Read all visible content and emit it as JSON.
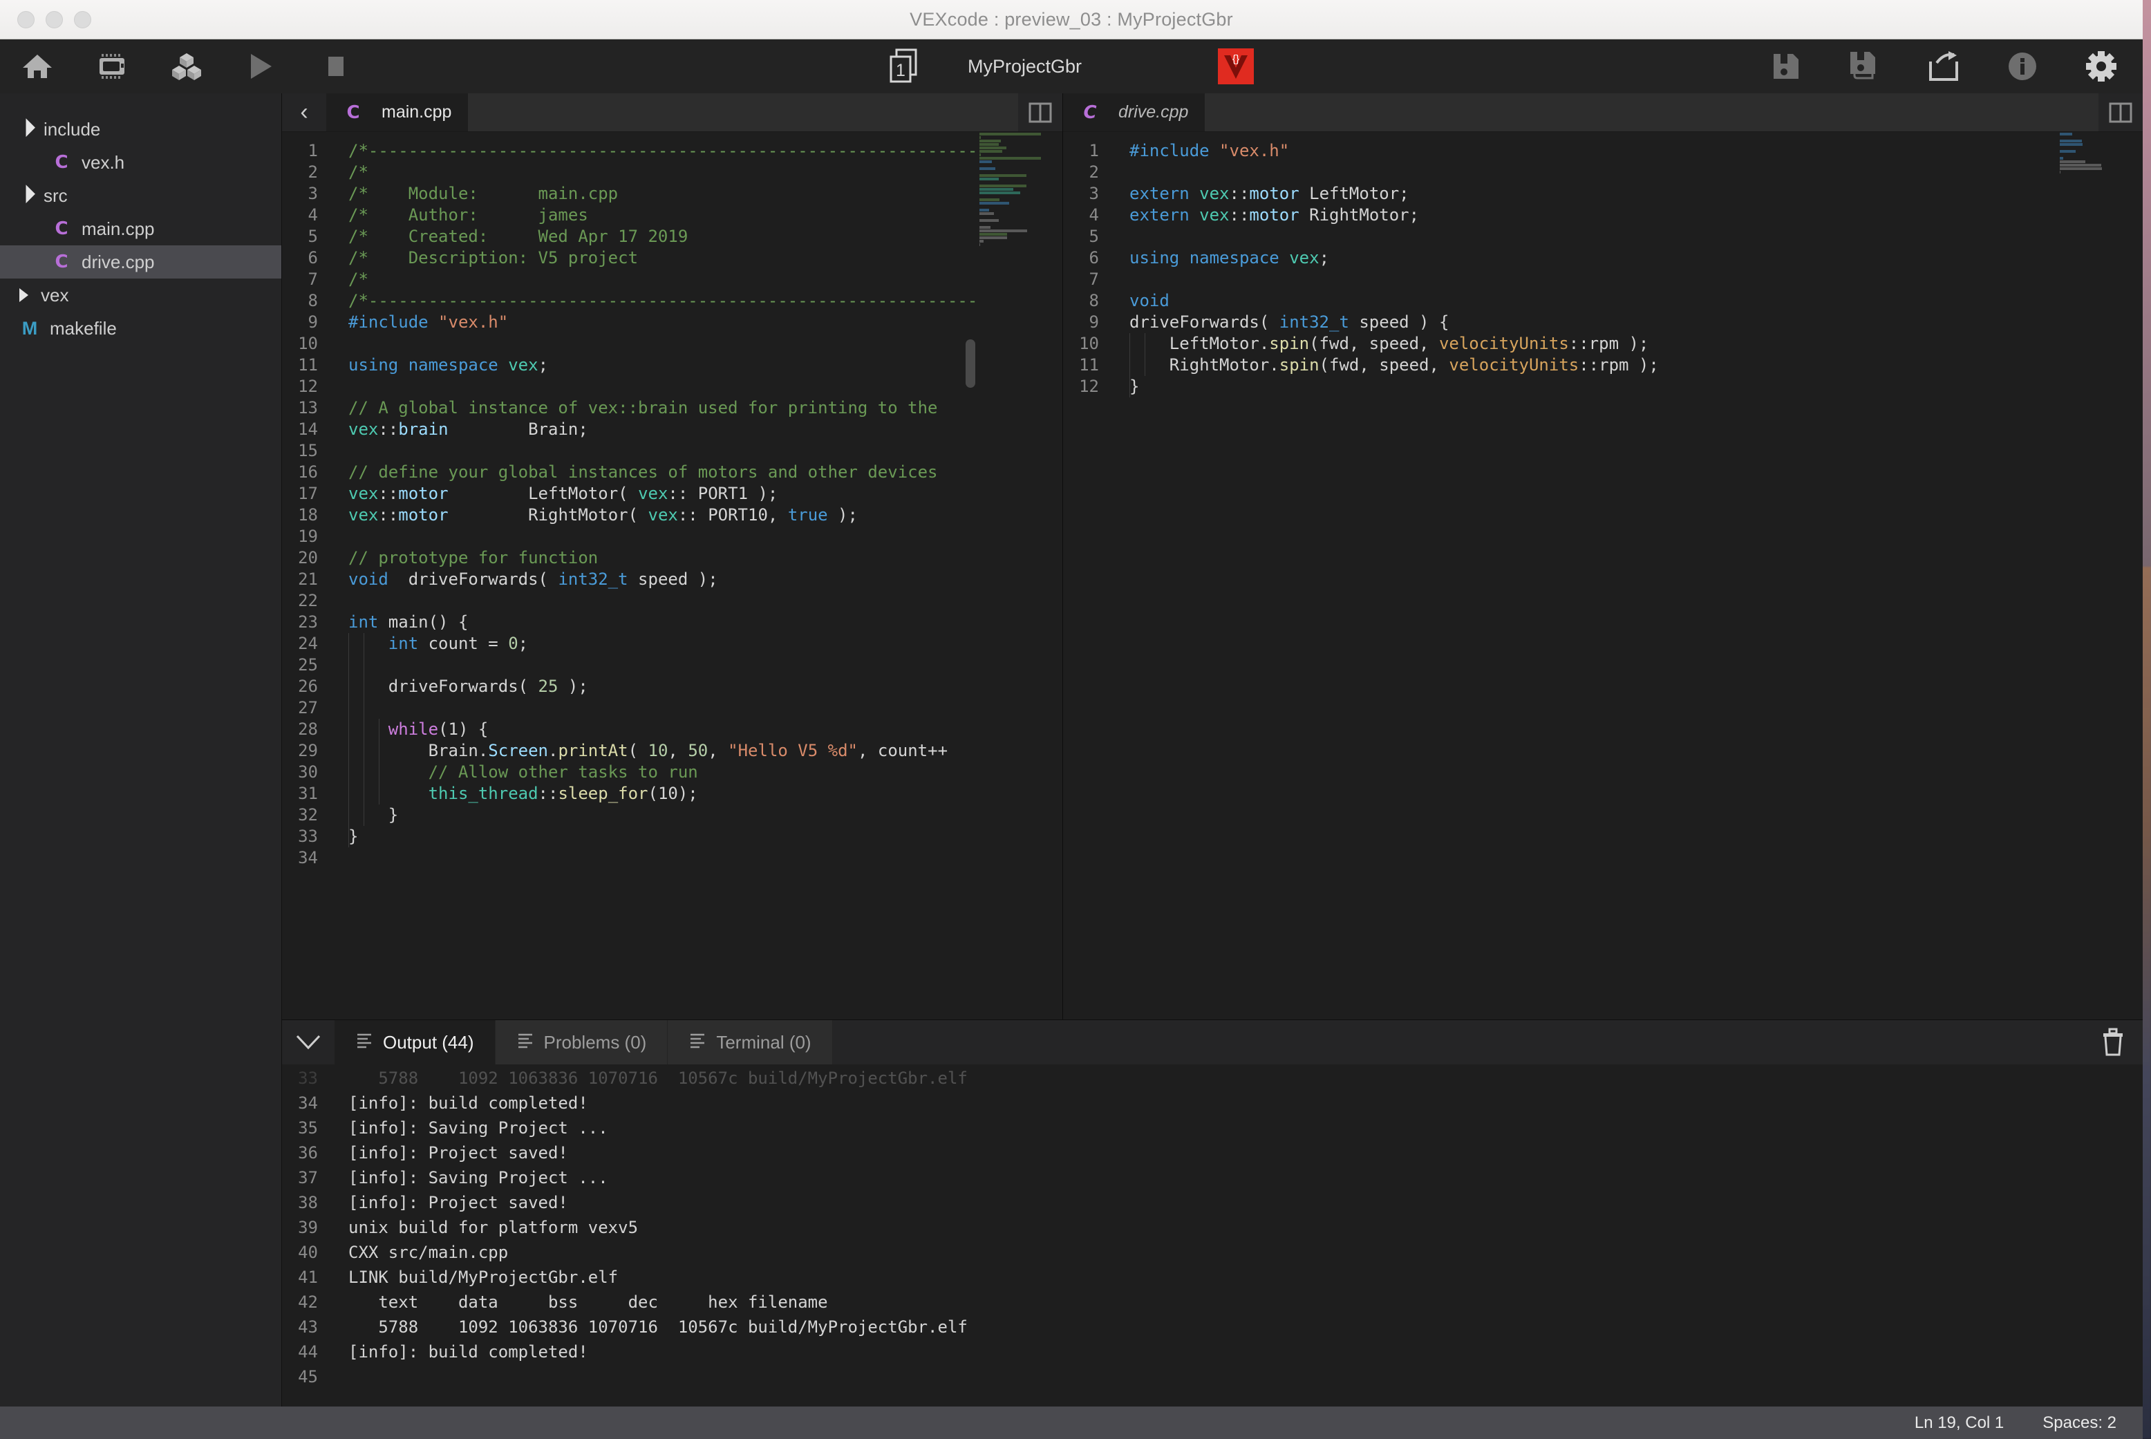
{
  "window": {
    "title": "VEXcode : preview_03 : MyProjectGbr"
  },
  "toolbar": {
    "icons": [
      {
        "name": "home-icon",
        "label": "Home"
      },
      {
        "name": "brain-device-icon",
        "label": "Device"
      },
      {
        "name": "blocks-icon",
        "label": "Blocks"
      },
      {
        "name": "run-icon",
        "label": "Run"
      },
      {
        "name": "stop-icon",
        "label": "Stop"
      }
    ],
    "slot_number": "1",
    "project_name": "MyProjectGbr",
    "logo_text": "{}",
    "logo_color": "#e02b20",
    "right_icons": [
      {
        "name": "save-icon",
        "label": "Save"
      },
      {
        "name": "save-as-icon",
        "label": "Save As"
      },
      {
        "name": "share-icon",
        "label": "Share"
      },
      {
        "name": "info-icon",
        "label": "Info"
      },
      {
        "name": "settings-gear-icon",
        "label": "Settings"
      }
    ]
  },
  "sidebar": {
    "items": [
      {
        "label": "include",
        "type": "folder",
        "expanded": true,
        "depth": 0,
        "selected": false
      },
      {
        "label": "vex.h",
        "type": "cpp",
        "depth": 1,
        "selected": false
      },
      {
        "label": "src",
        "type": "folder",
        "expanded": true,
        "depth": 0,
        "selected": false
      },
      {
        "label": "main.cpp",
        "type": "cpp",
        "depth": 1,
        "selected": false
      },
      {
        "label": "drive.cpp",
        "type": "cpp",
        "depth": 1,
        "selected": true
      },
      {
        "label": "vex",
        "type": "folder",
        "expanded": false,
        "depth": 0,
        "selected": false
      },
      {
        "label": "makefile",
        "type": "make",
        "depth": 0,
        "selected": false
      }
    ]
  },
  "editor_left": {
    "tab_label": "main.cpp",
    "back_glyph": "‹",
    "lines": [
      {
        "n": "1",
        "tokens": [
          {
            "t": "/*---------------------------------------------------------------------------",
            "c": "c-com"
          }
        ]
      },
      {
        "n": "2",
        "tokens": [
          {
            "t": "/*",
            "c": "c-com"
          }
        ]
      },
      {
        "n": "3",
        "tokens": [
          {
            "t": "/*    Module:      main.cpp",
            "c": "c-com"
          }
        ]
      },
      {
        "n": "4",
        "tokens": [
          {
            "t": "/*    Author:      james",
            "c": "c-com"
          }
        ]
      },
      {
        "n": "5",
        "tokens": [
          {
            "t": "/*    Created:     Wed Apr 17 2019",
            "c": "c-com"
          }
        ]
      },
      {
        "n": "6",
        "tokens": [
          {
            "t": "/*    Description: V5 project",
            "c": "c-com"
          }
        ]
      },
      {
        "n": "7",
        "tokens": [
          {
            "t": "/*",
            "c": "c-com"
          }
        ]
      },
      {
        "n": "8",
        "tokens": [
          {
            "t": "/*---------------------------------------------------------------------------",
            "c": "c-com"
          }
        ]
      },
      {
        "n": "9",
        "tokens": [
          {
            "t": "#include ",
            "c": "c-key"
          },
          {
            "t": "\"vex.h\"",
            "c": "c-str"
          }
        ]
      },
      {
        "n": "10",
        "tokens": []
      },
      {
        "n": "11",
        "tokens": [
          {
            "t": "using ",
            "c": "c-key"
          },
          {
            "t": "namespace ",
            "c": "c-key"
          },
          {
            "t": "vex",
            "c": "c-type"
          },
          {
            "t": ";",
            "c": "c-txt"
          }
        ]
      },
      {
        "n": "12",
        "tokens": []
      },
      {
        "n": "13",
        "tokens": [
          {
            "t": "// A global instance of vex::brain used for printing to the",
            "c": "c-com"
          }
        ]
      },
      {
        "n": "14",
        "tokens": [
          {
            "t": "vex",
            "c": "c-type"
          },
          {
            "t": "::",
            "c": "c-txt"
          },
          {
            "t": "brain",
            "c": "c-obj"
          },
          {
            "t": "        Brain;",
            "c": "c-txt"
          }
        ]
      },
      {
        "n": "15",
        "tokens": []
      },
      {
        "n": "16",
        "tokens": [
          {
            "t": "// define your global instances of motors and other devices",
            "c": "c-com"
          }
        ]
      },
      {
        "n": "17",
        "tokens": [
          {
            "t": "vex",
            "c": "c-type"
          },
          {
            "t": "::",
            "c": "c-txt"
          },
          {
            "t": "motor",
            "c": "c-obj"
          },
          {
            "t": "        LeftMotor( ",
            "c": "c-txt"
          },
          {
            "t": "vex",
            "c": "c-type"
          },
          {
            "t": ":: PORT1 );",
            "c": "c-txt"
          }
        ]
      },
      {
        "n": "18",
        "tokens": [
          {
            "t": "vex",
            "c": "c-type"
          },
          {
            "t": "::",
            "c": "c-txt"
          },
          {
            "t": "motor",
            "c": "c-obj"
          },
          {
            "t": "        RightMotor( ",
            "c": "c-txt"
          },
          {
            "t": "vex",
            "c": "c-type"
          },
          {
            "t": ":: PORT10, ",
            "c": "c-txt"
          },
          {
            "t": "true",
            "c": "c-key"
          },
          {
            "t": " );",
            "c": "c-txt"
          }
        ]
      },
      {
        "n": "19",
        "tokens": []
      },
      {
        "n": "20",
        "tokens": [
          {
            "t": "// prototype for function",
            "c": "c-com"
          }
        ]
      },
      {
        "n": "21",
        "tokens": [
          {
            "t": "void",
            "c": "c-key"
          },
          {
            "t": "  driveForwards( ",
            "c": "c-txt"
          },
          {
            "t": "int32_t",
            "c": "c-key"
          },
          {
            "t": " speed );",
            "c": "c-txt"
          }
        ]
      },
      {
        "n": "22",
        "tokens": []
      },
      {
        "n": "23",
        "tokens": [
          {
            "t": "int",
            "c": "c-key"
          },
          {
            "t": " main() {",
            "c": "c-txt"
          }
        ]
      },
      {
        "n": "24",
        "tokens": [
          {
            "t": "    ",
            "c": "c-txt"
          },
          {
            "t": "int",
            "c": "c-key"
          },
          {
            "t": " count = ",
            "c": "c-txt"
          },
          {
            "t": "0",
            "c": "c-num"
          },
          {
            "t": ";",
            "c": "c-txt"
          }
        ]
      },
      {
        "n": "25",
        "tokens": []
      },
      {
        "n": "26",
        "tokens": [
          {
            "t": "    driveForwards( ",
            "c": "c-txt"
          },
          {
            "t": "25",
            "c": "c-num"
          },
          {
            "t": " );",
            "c": "c-txt"
          }
        ]
      },
      {
        "n": "27",
        "tokens": []
      },
      {
        "n": "28",
        "tokens": [
          {
            "t": "    ",
            "c": "c-txt"
          },
          {
            "t": "while",
            "c": "c-kw2"
          },
          {
            "t": "(1) {",
            "c": "c-txt"
          }
        ]
      },
      {
        "n": "29",
        "tokens": [
          {
            "t": "        Brain.",
            "c": "c-txt"
          },
          {
            "t": "Screen",
            "c": "c-obj"
          },
          {
            "t": ".",
            "c": "c-txt"
          },
          {
            "t": "printAt",
            "c": "c-fn"
          },
          {
            "t": "( ",
            "c": "c-txt"
          },
          {
            "t": "10",
            "c": "c-num"
          },
          {
            "t": ", ",
            "c": "c-txt"
          },
          {
            "t": "50",
            "c": "c-num"
          },
          {
            "t": ", ",
            "c": "c-txt"
          },
          {
            "t": "\"Hello V5 %d\"",
            "c": "c-str"
          },
          {
            "t": ", count++",
            "c": "c-txt"
          }
        ]
      },
      {
        "n": "30",
        "tokens": [
          {
            "t": "        // Allow other tasks to run",
            "c": "c-com"
          }
        ]
      },
      {
        "n": "31",
        "tokens": [
          {
            "t": "        ",
            "c": "c-txt"
          },
          {
            "t": "this_thread",
            "c": "c-type"
          },
          {
            "t": "::",
            "c": "c-txt"
          },
          {
            "t": "sleep_for",
            "c": "c-fn"
          },
          {
            "t": "(10);",
            "c": "c-txt"
          }
        ]
      },
      {
        "n": "32",
        "tokens": [
          {
            "t": "    }",
            "c": "c-txt"
          }
        ]
      },
      {
        "n": "33",
        "tokens": [
          {
            "t": "}",
            "c": "c-txt"
          }
        ]
      },
      {
        "n": "34",
        "tokens": []
      }
    ]
  },
  "editor_right": {
    "tab_label": "drive.cpp",
    "lines": [
      {
        "n": "1",
        "tokens": [
          {
            "t": "#include ",
            "c": "c-key"
          },
          {
            "t": "\"vex.h\"",
            "c": "c-str"
          }
        ]
      },
      {
        "n": "2",
        "tokens": []
      },
      {
        "n": "3",
        "tokens": [
          {
            "t": "extern ",
            "c": "c-key"
          },
          {
            "t": "vex",
            "c": "c-type"
          },
          {
            "t": "::",
            "c": "c-txt"
          },
          {
            "t": "motor",
            "c": "c-obj"
          },
          {
            "t": " LeftMotor;",
            "c": "c-txt"
          }
        ]
      },
      {
        "n": "4",
        "tokens": [
          {
            "t": "extern ",
            "c": "c-key"
          },
          {
            "t": "vex",
            "c": "c-type"
          },
          {
            "t": "::",
            "c": "c-txt"
          },
          {
            "t": "motor",
            "c": "c-obj"
          },
          {
            "t": " RightMotor;",
            "c": "c-txt"
          }
        ]
      },
      {
        "n": "5",
        "tokens": []
      },
      {
        "n": "6",
        "tokens": [
          {
            "t": "using ",
            "c": "c-key"
          },
          {
            "t": "namespace ",
            "c": "c-key"
          },
          {
            "t": "vex",
            "c": "c-type"
          },
          {
            "t": ";",
            "c": "c-txt"
          }
        ]
      },
      {
        "n": "7",
        "tokens": []
      },
      {
        "n": "8",
        "tokens": [
          {
            "t": "void",
            "c": "c-key"
          }
        ]
      },
      {
        "n": "9",
        "tokens": [
          {
            "t": "driveForwards( ",
            "c": "c-txt"
          },
          {
            "t": "int32_t",
            "c": "c-key"
          },
          {
            "t": " speed ) {",
            "c": "c-txt"
          }
        ]
      },
      {
        "n": "10",
        "tokens": [
          {
            "t": "    LeftMotor.",
            "c": "c-txt"
          },
          {
            "t": "spin",
            "c": "c-fn"
          },
          {
            "t": "(fwd, speed, ",
            "c": "c-txt"
          },
          {
            "t": "velocityUnits",
            "c": "c-ora"
          },
          {
            "t": "::rpm );",
            "c": "c-txt"
          }
        ]
      },
      {
        "n": "11",
        "tokens": [
          {
            "t": "    RightMotor.",
            "c": "c-txt"
          },
          {
            "t": "spin",
            "c": "c-fn"
          },
          {
            "t": "(fwd, speed, ",
            "c": "c-txt"
          },
          {
            "t": "velocityUnits",
            "c": "c-ora"
          },
          {
            "t": "::rpm );",
            "c": "c-txt"
          }
        ]
      },
      {
        "n": "12",
        "tokens": [
          {
            "t": "}",
            "c": "c-txt"
          }
        ]
      }
    ]
  },
  "bottom_panel": {
    "collapse_glyph": "⌄",
    "tabs": [
      {
        "label": "Output (44)",
        "active": true
      },
      {
        "label": "Problems (0)",
        "active": false
      },
      {
        "label": "Terminal (0)",
        "active": false
      }
    ],
    "clear_icon": "trash-icon",
    "output_lines": [
      {
        "n": "33",
        "text": "   5788    1092 1063836 1070716  10567c build/MyProjectGbr.elf",
        "faded": true
      },
      {
        "n": "34",
        "text": "[info]: build completed!"
      },
      {
        "n": "35",
        "text": "[info]: Saving Project ..."
      },
      {
        "n": "36",
        "text": "[info]: Project saved!"
      },
      {
        "n": "37",
        "text": "[info]: Saving Project ..."
      },
      {
        "n": "38",
        "text": "[info]: Project saved!"
      },
      {
        "n": "39",
        "text": "unix build for platform vexv5"
      },
      {
        "n": "40",
        "text": "CXX src/main.cpp"
      },
      {
        "n": "41",
        "text": "LINK build/MyProjectGbr.elf"
      },
      {
        "n": "42",
        "text": "   text    data     bss     dec     hex filename"
      },
      {
        "n": "43",
        "text": "   5788    1092 1063836 1070716  10567c build/MyProjectGbr.elf"
      },
      {
        "n": "44",
        "text": "[info]: build completed!"
      },
      {
        "n": "45",
        "text": ""
      }
    ]
  },
  "statusbar": {
    "cursor_position": "Ln 19, Col 1",
    "indentation": "Spaces: 2"
  }
}
